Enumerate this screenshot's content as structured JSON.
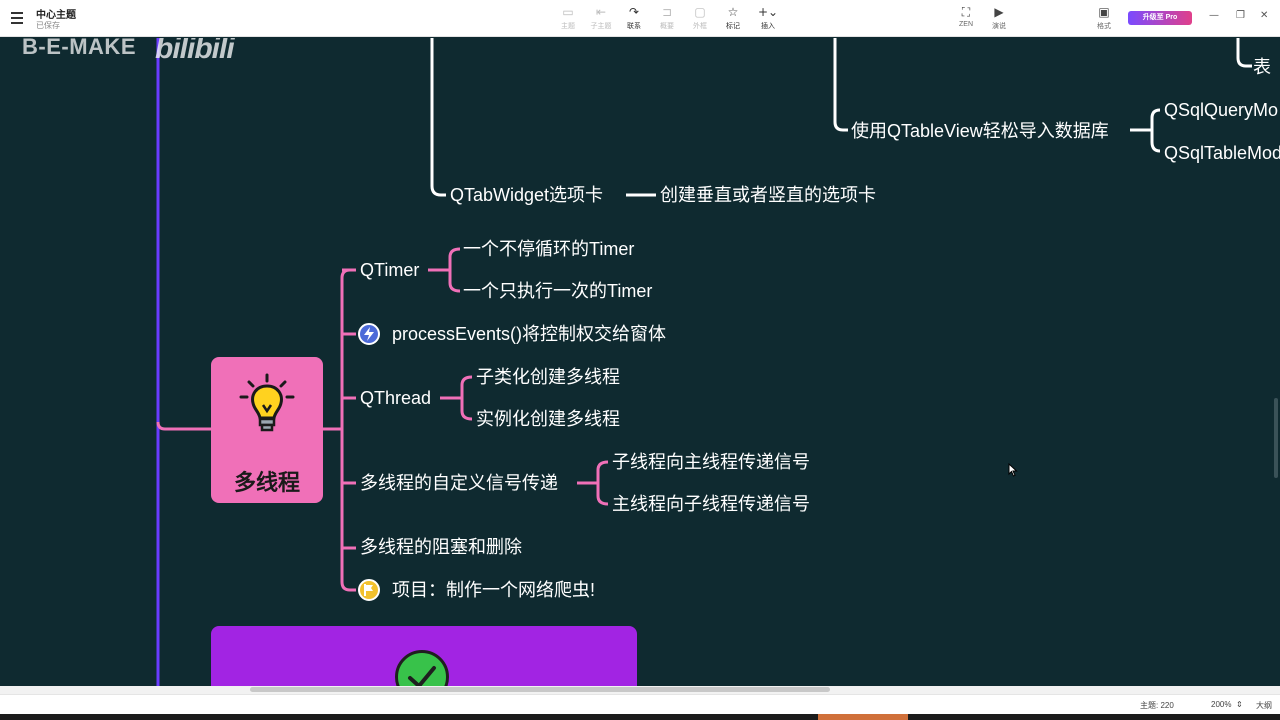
{
  "window": {
    "title": "中心主题",
    "status": "已保存"
  },
  "toolbar": {
    "items": [
      {
        "label": "主题",
        "icon": "topic-icon",
        "glyph": "▭"
      },
      {
        "label": "子主题",
        "icon": "subtopic-icon",
        "glyph": "⇤"
      },
      {
        "label": "联系",
        "icon": "relationship-icon",
        "glyph": "↷"
      },
      {
        "label": "概要",
        "icon": "summary-icon",
        "glyph": "⊐"
      },
      {
        "label": "外框",
        "icon": "boundary-icon",
        "glyph": "▢"
      },
      {
        "label": "标记",
        "icon": "star-icon",
        "glyph": "☆"
      },
      {
        "label": "插入",
        "icon": "plus-icon",
        "glyph": "+⌄"
      }
    ],
    "zen": {
      "label": "ZEN",
      "glyph": "⛶"
    },
    "present": {
      "label": "演说",
      "glyph": "▶"
    },
    "format": {
      "label": "格式",
      "glyph": "▣"
    },
    "upgrade_label": "升级至 Pro"
  },
  "watermark": {
    "text": "B-E-MAKE",
    "logo_text": "bilibili"
  },
  "upper_branches": {
    "db_import": "使用QTableView轻松导入数据库",
    "sql_query_model": "QSqlQueryMo",
    "sql_table_model": "QSqlTableMod",
    "cut_text": "表",
    "tab_widget": "QTabWidget选项卡",
    "tab_widget_desc": "创建垂直或者竖直的选项卡"
  },
  "central_topic": {
    "title": "多线程"
  },
  "branches": {
    "qtimer": {
      "label": "QTimer",
      "children": [
        "一个不停循环的Timer",
        "一个只执行一次的Timer"
      ]
    },
    "process_events": {
      "label": "processEvents()将控制权交给窗体"
    },
    "qthread": {
      "label": "QThread",
      "children": [
        "子类化创建多线程",
        "实例化创建多线程"
      ]
    },
    "custom_signal": {
      "label": "多线程的自定义信号传递",
      "children": [
        "子线程向主线程传递信号",
        "主线程向子线程传递信号"
      ]
    },
    "block_delete": {
      "label": "多线程的阻塞和删除"
    },
    "project": {
      "label": "项目：制作一个网络爬虫!"
    }
  },
  "statusbar": {
    "topic_count": "主题: 220",
    "zoom": "200%",
    "outline": "大纲"
  },
  "colors": {
    "canvas_bg": "#0f2a30",
    "branch_pink": "#f070b8",
    "spine_purple": "#6a3cff",
    "card_purple": "#a224e3",
    "line_white": "#ffffff"
  }
}
